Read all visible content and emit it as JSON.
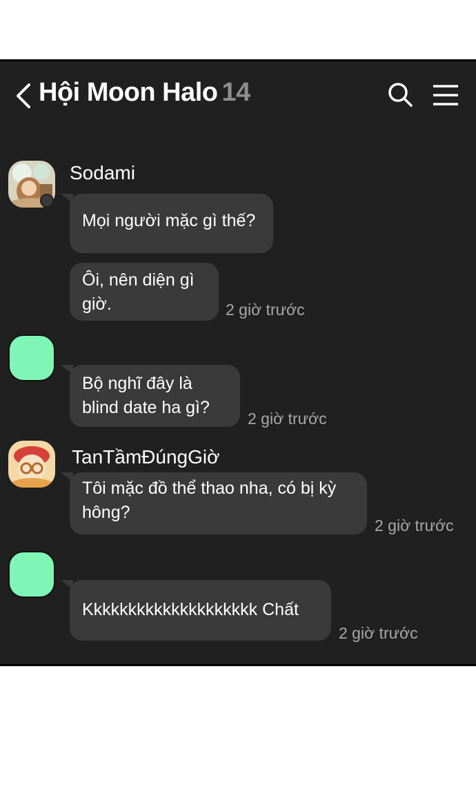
{
  "header": {
    "title": "Hội Moon Halo",
    "member_count": "14",
    "back_icon": "chevron-left-icon",
    "search_icon": "search-icon",
    "menu_icon": "menu-icon"
  },
  "colors": {
    "background": "#202020",
    "bubble": "#3a3a3a",
    "mint_avatar": "#7ff5b6",
    "timestamp": "#a8a8a8"
  },
  "messages": [
    {
      "sender": "Sodami",
      "text": "Mọi người mặc gì thế?",
      "time": ""
    },
    {
      "sender": "",
      "text": "Ôi, nên diện gì giờ.",
      "time": "2 giờ trước"
    },
    {
      "sender": "",
      "text": "Bộ nghĩ đây là blind date ha gì?",
      "time": "2 giờ trước"
    },
    {
      "sender": "TanTầmĐúngGiờ",
      "text": "Tôi mặc đồ thể thao nha, có bị kỳ hông?",
      "time": "2 giờ trước"
    },
    {
      "sender": "",
      "text": "Kkkkkkkkkkkkkkkkkkkk Chất",
      "time": "2 giờ trước"
    }
  ]
}
